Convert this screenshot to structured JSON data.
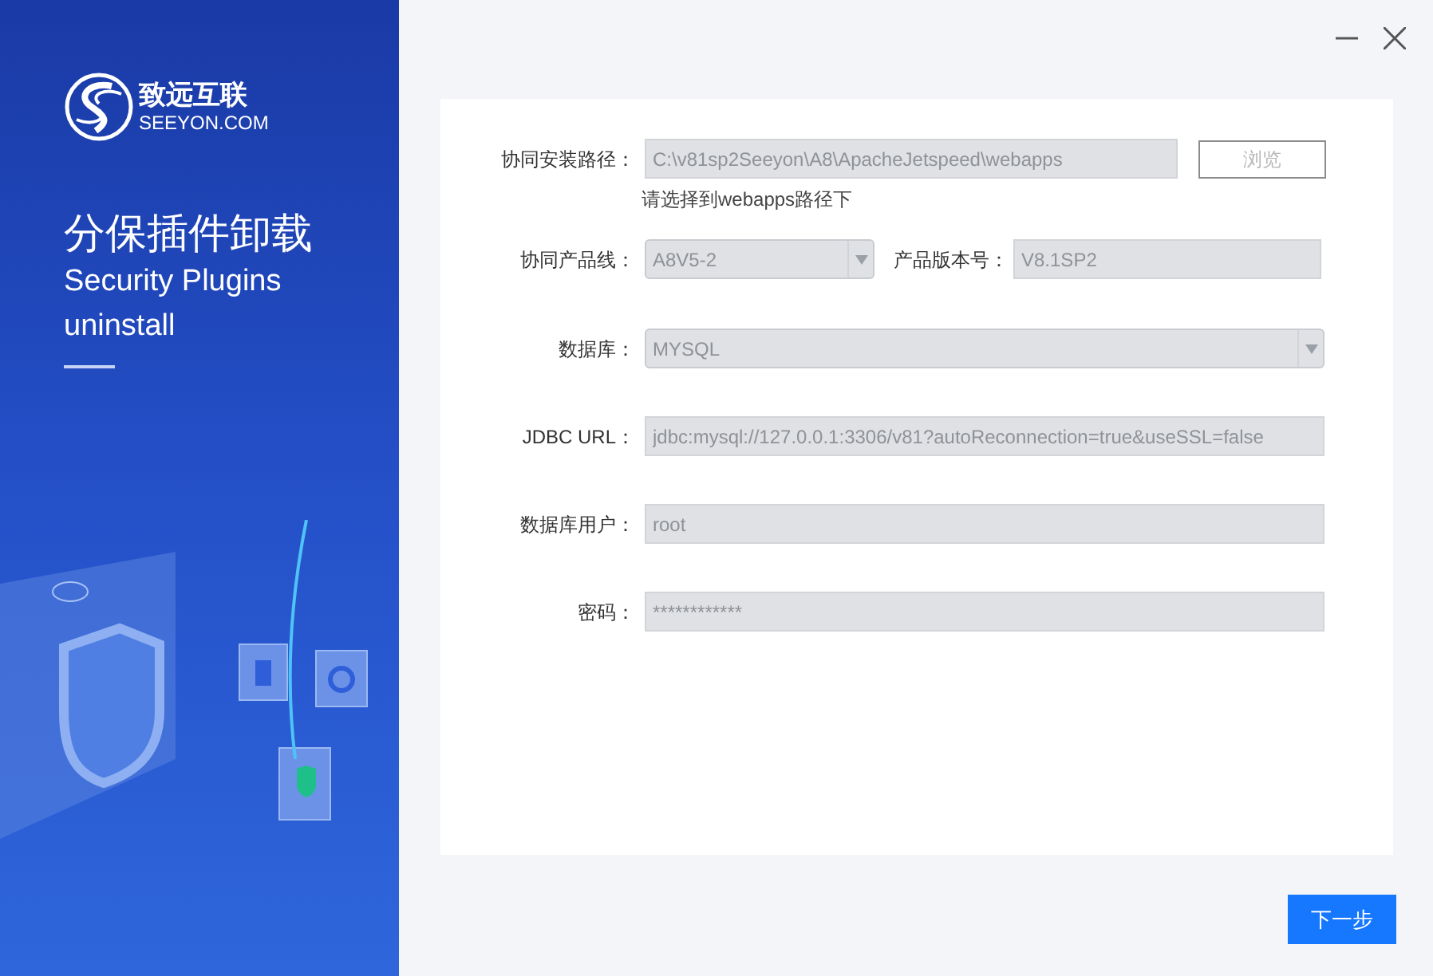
{
  "brand": {
    "name": "致远互联",
    "domain": "SEEYON.COM"
  },
  "hero": {
    "title": "分保插件卸载",
    "subtitle": [
      "Security Plugins",
      "uninstall"
    ]
  },
  "form": [
    {
      "kind": "path",
      "label": "协同安装路径：",
      "value": "C:\\v81sp2Seeyon\\A8\\ApacheJetspeed\\webapps",
      "button": {
        "label": "浏览",
        "disabled": true
      },
      "hint": "请选择到webapps路径下"
    },
    {
      "kind": "pair",
      "label": "协同产品线：",
      "value": "A8V5-2",
      "label2": "产品版本号：",
      "value2": "V8.1SP2"
    },
    {
      "kind": "select",
      "label": "数据库：",
      "value": "MYSQL"
    },
    {
      "kind": "text",
      "label": "JDBC URL：",
      "value": "jdbc:mysql://127.0.0.1:3306/v81?autoReconnection=true&useSSL=false"
    },
    {
      "kind": "text",
      "label": "数据库用户：",
      "value": "root"
    },
    {
      "kind": "text",
      "label": "密码：",
      "value": "************"
    }
  ],
  "next_button": "下一步"
}
